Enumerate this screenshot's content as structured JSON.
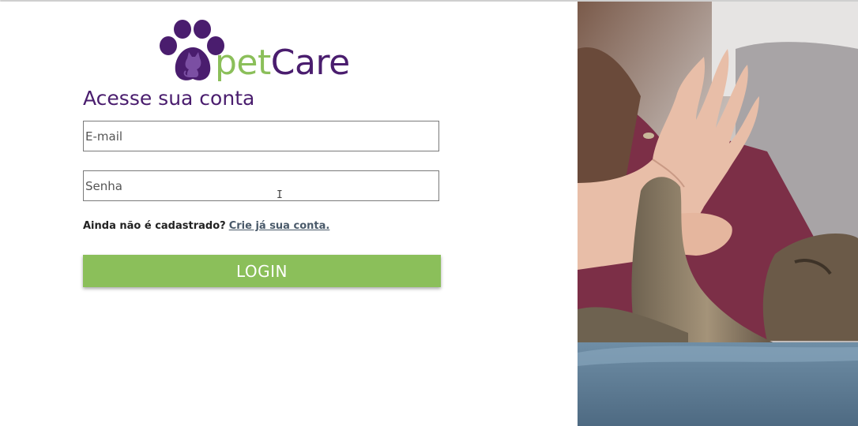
{
  "brand": {
    "name_part1": "pet",
    "name_part2": "Care"
  },
  "login": {
    "title": "Acesse sua conta",
    "email_placeholder": "E-mail",
    "password_placeholder": "Senha",
    "signup_prompt": "Ainda não é cadastrado?",
    "signup_link": "Crie já sua conta.",
    "button_label": "LOGIN"
  },
  "colors": {
    "brand_purple": "#4a1d6e",
    "brand_green": "#8bbf5a"
  },
  "icons": {
    "logo_icon": "paw-with-cat-icon"
  }
}
